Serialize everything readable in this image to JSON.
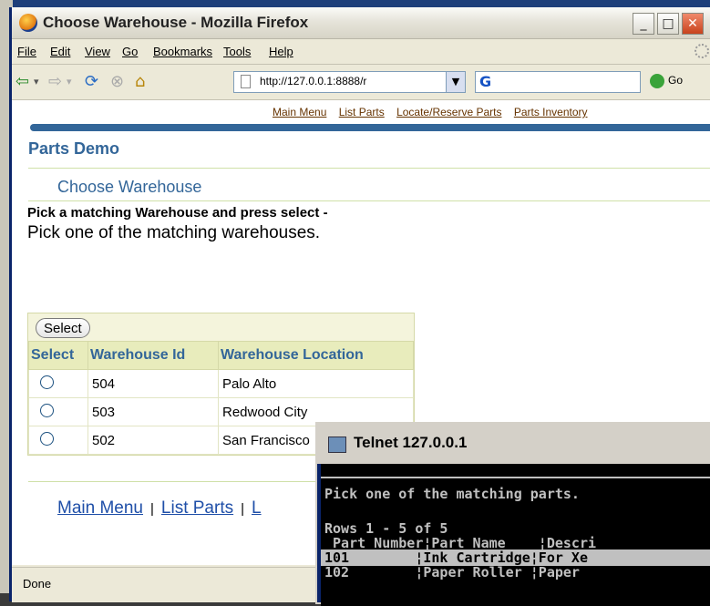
{
  "window": {
    "title": "Choose Warehouse - Mozilla Firefox"
  },
  "menu": [
    "File",
    "Edit",
    "View",
    "Go",
    "Bookmarks",
    "Tools",
    "Help"
  ],
  "nav": {
    "url": "http://127.0.0.1:8888/r",
    "go_label": "Go",
    "search_engine": "G"
  },
  "page": {
    "global_links": [
      "Main Menu",
      "List Parts",
      "Locate/Reserve Parts",
      "Parts Inventory"
    ],
    "brand": "Parts Demo",
    "header": "Choose Warehouse",
    "instruction_bold": "Pick a matching Warehouse and press select -",
    "instruction": "Pick one of the matching warehouses.",
    "select_button": "Select",
    "columns": [
      "Select",
      "Warehouse Id",
      "Warehouse Location"
    ],
    "rows": [
      {
        "id": "504",
        "location": "Palo Alto"
      },
      {
        "id": "503",
        "location": "Redwood City"
      },
      {
        "id": "502",
        "location": "San Francisco"
      }
    ],
    "footer_links": [
      "Main Menu",
      "List Parts",
      "L"
    ]
  },
  "status": "Done",
  "telnet": {
    "title": "Telnet 127.0.0.1",
    "line1": "Pick one of the matching parts.",
    "line2": "Rows 1 - 5 of 5",
    "header": " Part Number¦Part Name    ¦Descri",
    "row1": "101        ¦Ink Cartridge¦For Xe",
    "row2": "102        ¦Paper Roller ¦Paper "
  }
}
